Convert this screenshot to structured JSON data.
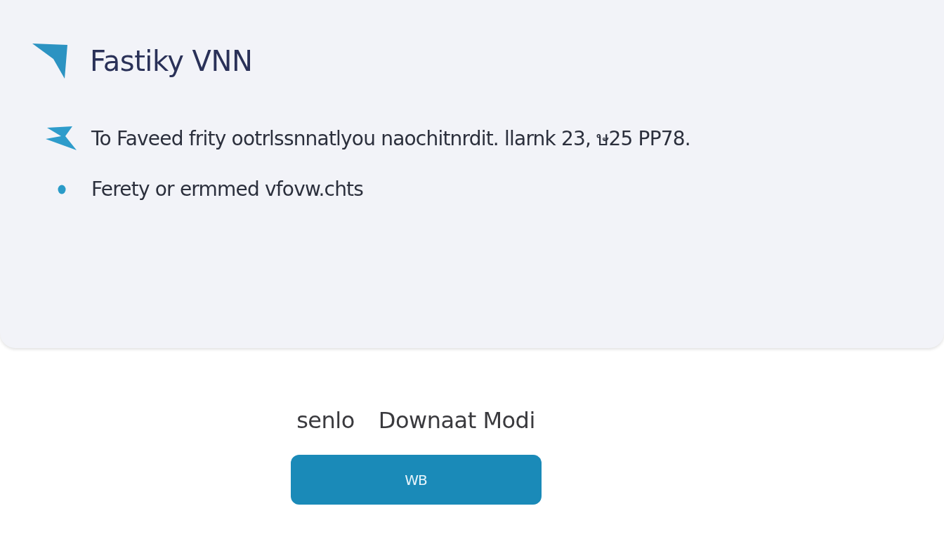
{
  "header": {
    "title": "Fastiky VNN"
  },
  "features": [
    {
      "kind": "arrow",
      "text": "To Faveed frity ootrlssnnatlyou naochitnrdit. llarnk 23, ษ25 PP78."
    },
    {
      "kind": "dot",
      "text": "Ferety or ermmed vfovw.chts"
    }
  ],
  "download": {
    "caption_prefix": "senlo",
    "caption": "Downaat Modi",
    "button": "WB"
  }
}
